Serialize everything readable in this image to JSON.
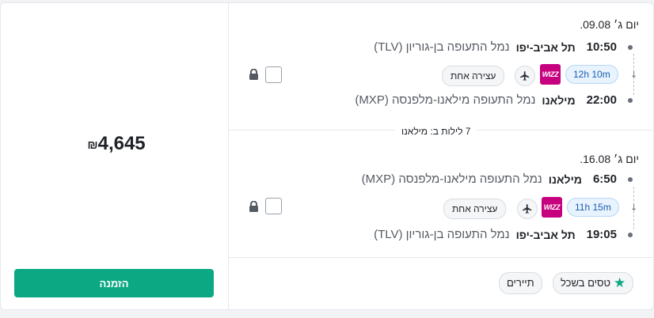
{
  "price": {
    "amount": "4,645",
    "currency": "₪"
  },
  "book_label": "הזמנה",
  "outbound": {
    "date": "יום ג׳ 09.08.",
    "depart": {
      "time": "10:50",
      "city": "תל אביב-יפו",
      "airport": "נמל התעופה בן-גוריון (TLV)"
    },
    "arrive": {
      "time": "22:00",
      "city": "מילאנו",
      "airport": "נמל התעופה מילאנו-מלפנסה (MXP)"
    },
    "duration": "12h 10m",
    "airline_logo": "wizz",
    "stops": "עצירה אחת"
  },
  "nights": "7 לילות ב: מילאנו",
  "inbound": {
    "date": "יום ג׳ 16.08.",
    "depart": {
      "time": "6:50",
      "city": "מילאנו",
      "airport": "נמל התעופה מילאנו-מלפנסה (MXP)"
    },
    "arrive": {
      "time": "19:05",
      "city": "תל אביב-יפו",
      "airport": "נמל התעופה בן-גוריון (TLV)"
    },
    "duration": "11h 15m",
    "airline_logo": "wizz",
    "stops": "עצירה אחת"
  },
  "tags": {
    "smart": "טסים בשכל",
    "tourists": "תיירים"
  },
  "colors": {
    "accent": "#0ba883",
    "wizz": "#c6007e",
    "duration_bg": "#e8f3fe"
  }
}
